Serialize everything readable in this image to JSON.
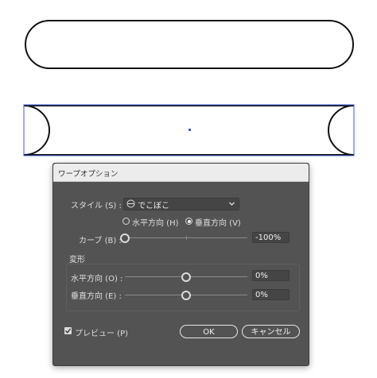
{
  "dialog": {
    "title": "ワープオプション",
    "style_label": "スタイル (S) :",
    "style_value": "でこぼこ",
    "style_icon": "bulge-icon",
    "orientation": {
      "horizontal": "水平方向 (H)",
      "vertical": "垂直方向 (V)",
      "selected": "vertical"
    },
    "bend": {
      "label": "カーブ (B) :",
      "value": "-100%",
      "fraction": 0.0
    },
    "distortion": {
      "group_label": "変形",
      "horizontal": {
        "label": "水平方向 (O) :",
        "value": "0%",
        "fraction": 0.5
      },
      "vertical": {
        "label": "垂直方向 (E) :",
        "value": "0%",
        "fraction": 0.5
      }
    },
    "preview": {
      "label": "プレビュー (P)",
      "checked": true
    },
    "ok_label": "OK",
    "cancel_label": "キャンセル"
  },
  "colors": {
    "dialog_bg": "#535353",
    "titlebar_bg": "#ececec",
    "selection": "#3b5bd6"
  }
}
